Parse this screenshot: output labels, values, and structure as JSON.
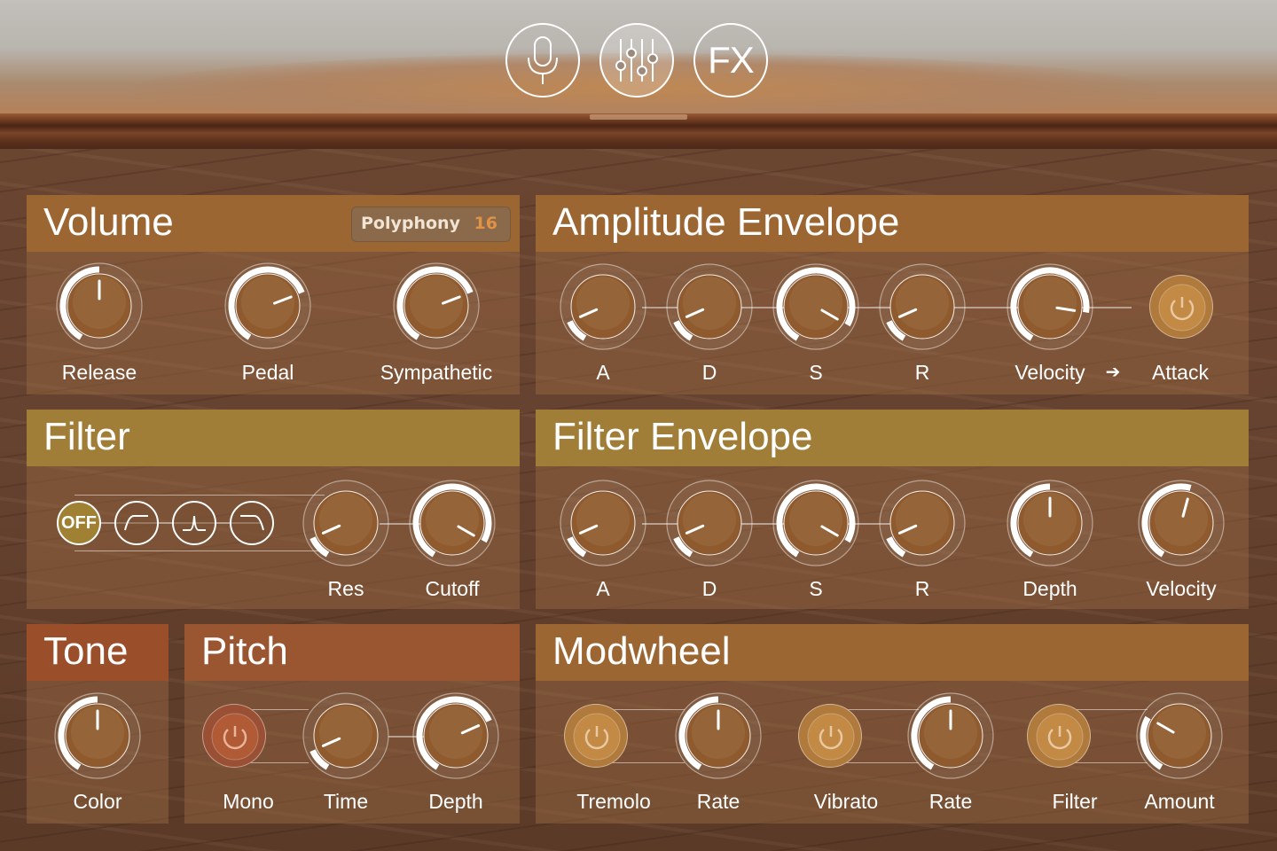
{
  "topbar": {
    "buttons": [
      {
        "icon": "microphone-icon",
        "label": ""
      },
      {
        "icon": "mixer-sliders-icon",
        "label": ""
      },
      {
        "icon": "fx-icon",
        "label": "FX"
      }
    ]
  },
  "colors": {
    "volume_header": "#9c6632",
    "amp_header": "#9c6632",
    "filter_header": "#a07e38",
    "filter_env_header": "#a07e38",
    "tone_header": "#9a4f2a",
    "pitch_header": "#9a5630",
    "modwheel_header": "#9c6632"
  },
  "volume": {
    "title": "Volume",
    "polyphony_label": "Polyphony",
    "polyphony_value": "16",
    "knobs": [
      {
        "label": "Release",
        "value": 0.5
      },
      {
        "label": "Pedal",
        "value": 0.73
      },
      {
        "label": "Sympathetic",
        "value": 0.73
      }
    ]
  },
  "amp_env": {
    "title": "Amplitude Envelope",
    "knobs": [
      {
        "label": "A",
        "value": 0.12
      },
      {
        "label": "D",
        "value": 0.12
      },
      {
        "label": "S",
        "value": 0.9
      },
      {
        "label": "R",
        "value": 0.12
      },
      {
        "label": "Velocity",
        "value": 0.83
      }
    ],
    "arrow": "➔",
    "attack_label": "Attack",
    "attack_icon": "power-icon"
  },
  "filter": {
    "title": "Filter",
    "types": [
      {
        "name": "off",
        "label": "OFF"
      },
      {
        "name": "lowpass-icon",
        "label": ""
      },
      {
        "name": "bandpass-icon",
        "label": ""
      },
      {
        "name": "highpass-icon",
        "label": ""
      }
    ],
    "knobs": [
      {
        "label": "Res",
        "value": 0.12
      },
      {
        "label": "Cutoff",
        "value": 0.9
      }
    ]
  },
  "filter_env": {
    "title": "Filter Envelope",
    "knobs": [
      {
        "label": "A",
        "value": 0.12
      },
      {
        "label": "D",
        "value": 0.12
      },
      {
        "label": "S",
        "value": 0.9
      },
      {
        "label": "R",
        "value": 0.12
      },
      {
        "label": "Depth",
        "value": 0.5
      },
      {
        "label": "Velocity",
        "value": 0.55
      }
    ]
  },
  "tone": {
    "title": "Tone",
    "knobs": [
      {
        "label": "Color",
        "value": 0.5
      }
    ]
  },
  "pitch": {
    "title": "Pitch",
    "mono_label": "Mono",
    "mono_icon": "power-icon",
    "knobs": [
      {
        "label": "Time",
        "value": 0.12
      },
      {
        "label": "Depth",
        "value": 0.72
      }
    ]
  },
  "modwheel": {
    "title": "Modwheel",
    "groups": [
      {
        "toggle_label": "Tremolo",
        "knob_label": "Rate",
        "knob_value": 0.5
      },
      {
        "toggle_label": "Vibrato",
        "knob_label": "Rate",
        "knob_value": 0.5
      },
      {
        "toggle_label": "Filter",
        "knob_label": "Amount",
        "knob_value": 0.3
      }
    ]
  }
}
